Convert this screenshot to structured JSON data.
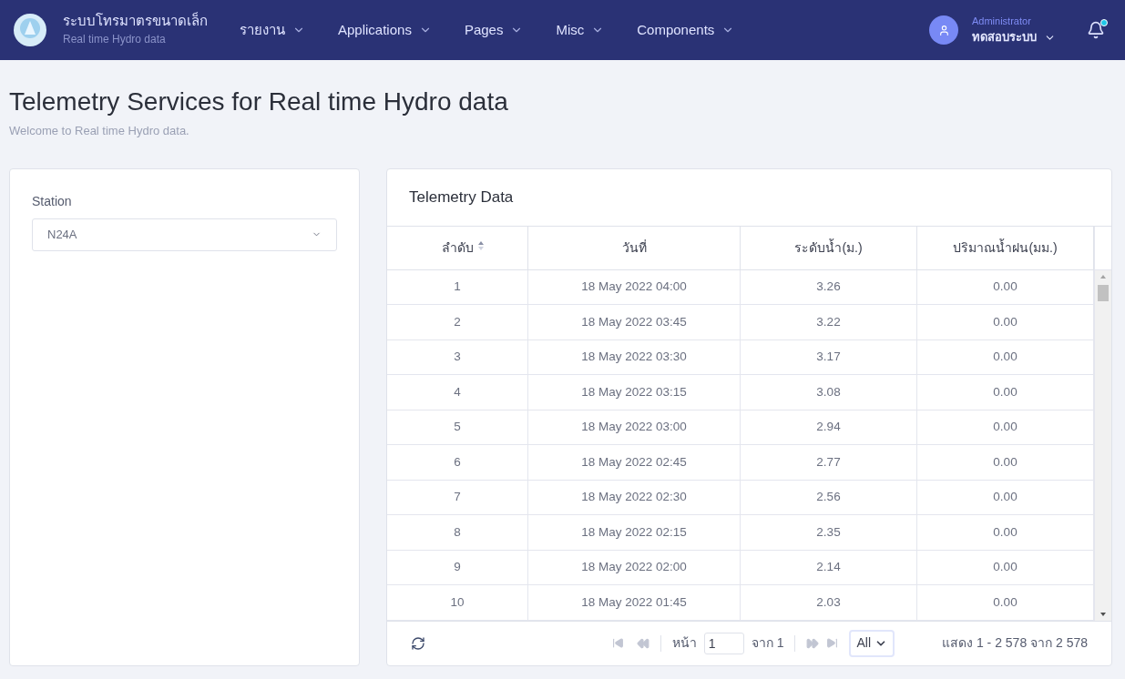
{
  "navbar": {
    "brand_title": "ระบบโทรมาตรขนาดเล็ก",
    "brand_subtitle": "Real time Hydro data",
    "menu": [
      {
        "label": "รายงาน"
      },
      {
        "label": "Applications"
      },
      {
        "label": "Pages"
      },
      {
        "label": "Misc"
      },
      {
        "label": "Components"
      }
    ],
    "user": {
      "role": "Administrator",
      "name": "ทดสอบระบบ"
    },
    "notification_dot": true
  },
  "page": {
    "title": "Telemetry Services for Real time Hydro data",
    "subtitle": "Welcome to Real time Hydro data."
  },
  "station_panel": {
    "label": "Station",
    "value": "N24A"
  },
  "table": {
    "title": "Telemetry Data",
    "columns": [
      "ลำดับ",
      "วันที่",
      "ระดับน้ำ(ม.)",
      "ปริมาณน้ำฝน(มม.)"
    ],
    "rows": [
      [
        "1",
        "18 May 2022 04:00",
        "3.26",
        "0.00"
      ],
      [
        "2",
        "18 May 2022 03:45",
        "3.22",
        "0.00"
      ],
      [
        "3",
        "18 May 2022 03:30",
        "3.17",
        "0.00"
      ],
      [
        "4",
        "18 May 2022 03:15",
        "3.08",
        "0.00"
      ],
      [
        "5",
        "18 May 2022 03:00",
        "2.94",
        "0.00"
      ],
      [
        "6",
        "18 May 2022 02:45",
        "2.77",
        "0.00"
      ],
      [
        "7",
        "18 May 2022 02:30",
        "2.56",
        "0.00"
      ],
      [
        "8",
        "18 May 2022 02:15",
        "2.35",
        "0.00"
      ],
      [
        "9",
        "18 May 2022 02:00",
        "2.14",
        "0.00"
      ],
      [
        "10",
        "18 May 2022 01:45",
        "2.03",
        "0.00"
      ]
    ]
  },
  "pager": {
    "page_label": "หน้า",
    "page_value": "1",
    "of_label": "จาก 1",
    "page_size": "All",
    "summary": "แสดง 1 - 2 578 จาก 2 578"
  }
}
